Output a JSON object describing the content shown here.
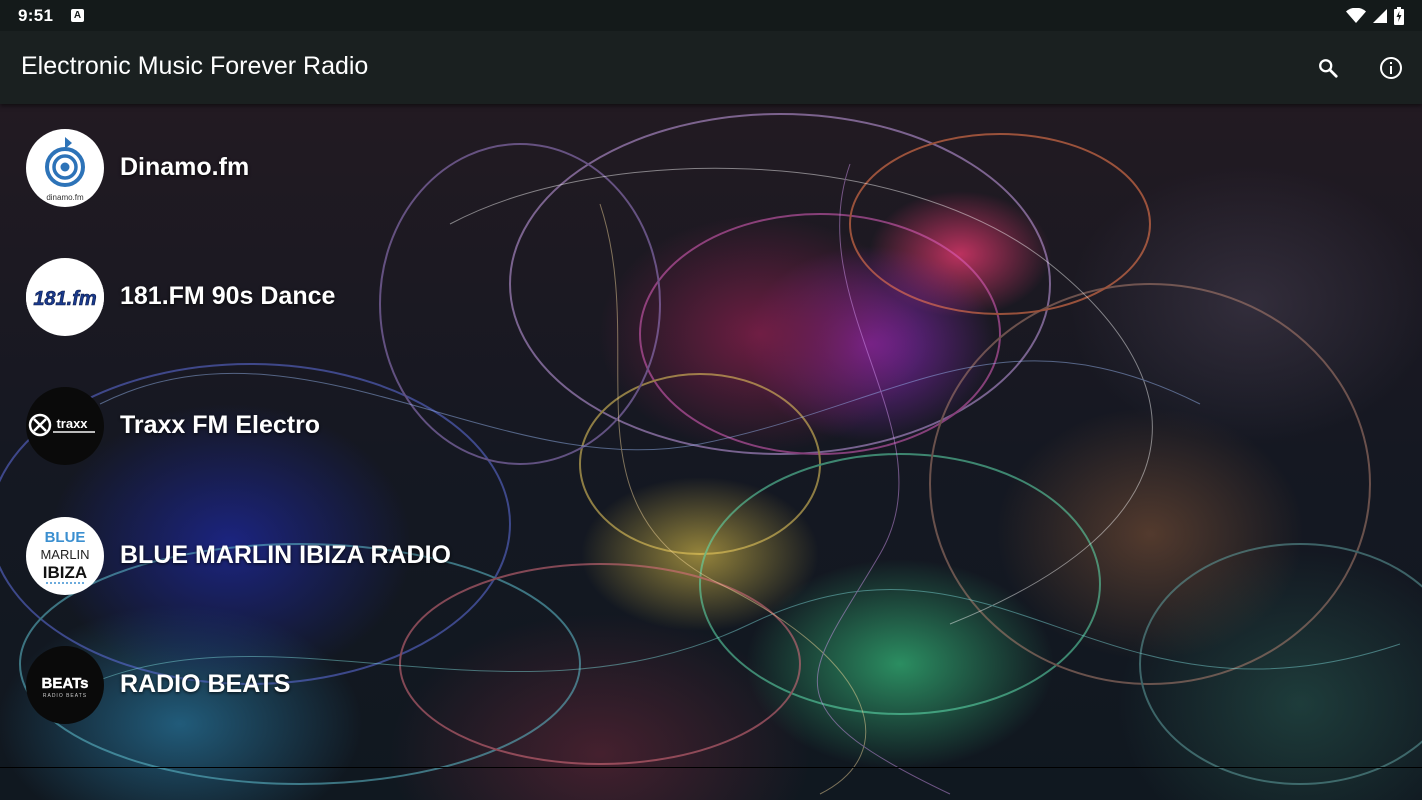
{
  "status_bar": {
    "time": "9:51",
    "notification_icon": "A"
  },
  "app_bar": {
    "title": "Electronic Music Forever Radio",
    "actions": [
      "search-icon",
      "info-icon"
    ]
  },
  "stations": [
    {
      "name": "Dinamo.fm",
      "logo": "dinamo-logo",
      "logo_caption": "dinamo.fm"
    },
    {
      "name": "181.FM 90s Dance",
      "logo": "181fm-logo",
      "logo_caption": "181.fm"
    },
    {
      "name": "Traxx FM Electro",
      "logo": "traxx-logo",
      "logo_caption": "traxx"
    },
    {
      "name": "BLUE MARLIN IBIZA RADIO",
      "logo": "blue-marlin-logo",
      "logo_caption": [
        "BLUE",
        "MARLIN",
        "IBIZA"
      ]
    },
    {
      "name": "RADIO BEATS",
      "logo": "radio-beats-logo",
      "logo_caption": "BEATs",
      "logo_subcaption": "RADIO BEATS"
    }
  ],
  "colors": {
    "status_bar": "#141a1a",
    "app_bar": "#1a2020",
    "text": "#ffffff",
    "blue_marlin_accent": "#3b8fd0",
    "dinamo_accent": "#2d73b8"
  }
}
